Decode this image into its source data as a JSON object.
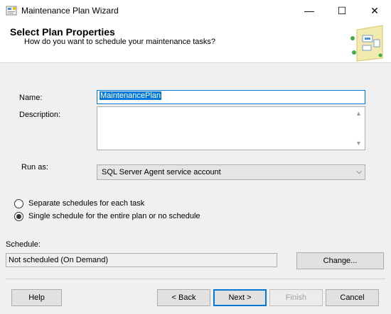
{
  "window": {
    "title": "Maintenance Plan Wizard",
    "controls": {
      "minimize": "—",
      "maximize": "☐",
      "close": "✕"
    }
  },
  "header": {
    "title": "Select Plan Properties",
    "subtitle": "How do you want to schedule your maintenance tasks?"
  },
  "form": {
    "name_label": "Name:",
    "name_value": "MaintenancePlan",
    "description_label": "Description:",
    "description_value": "",
    "runas_label": "Run as:",
    "runas_value": "SQL Server Agent service account"
  },
  "schedule_options": [
    {
      "label": "Separate schedules for each task",
      "selected": false
    },
    {
      "label": "Single schedule for the entire plan or no schedule",
      "selected": true
    }
  ],
  "schedule": {
    "label": "Schedule:",
    "value": "Not scheduled (On Demand)",
    "change_label": "Change..."
  },
  "footer": {
    "help": "Help",
    "back": "< Back",
    "next": "Next >",
    "finish": "Finish",
    "cancel": "Cancel"
  },
  "colors": {
    "accent": "#0078d7",
    "face": "#f0f0f0"
  },
  "icons": [
    "wizard-app-icon",
    "header-illustration-icon",
    "chevron-down-icon",
    "scroll-up-icon",
    "scroll-down-icon"
  ]
}
